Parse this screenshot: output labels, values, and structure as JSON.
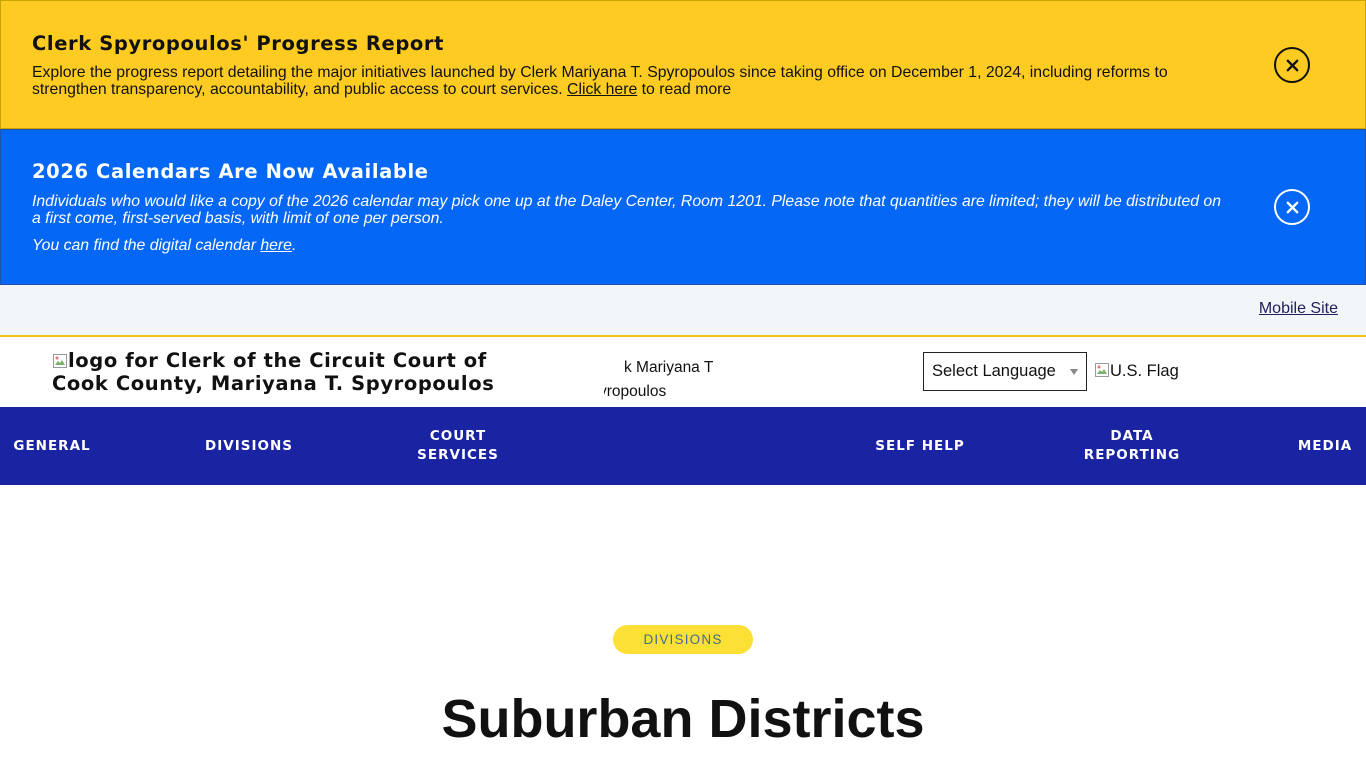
{
  "alerts": [
    {
      "title": "Clerk Spyropoulos' Progress Report",
      "body": "Explore the progress report detailing the major initiatives launched by Clerk Mariyana T. Spyropoulos since taking office on December 1, 2024, including reforms to strengthen transparency, accountability, and public access to court services.",
      "link_text": "Click here",
      "after_link": "to read more",
      "color": "#fdcb22"
    },
    {
      "title": "2026 Calendars Are Now Available",
      "body": "Individuals who would like a copy of the 2026 calendar may pick one up at the Daley Center, Room 1201. Please note that quantities are limited; they will be distributed on a first come, first-served basis, with limit of one per person.",
      "body2_prefix": "You can find the digital calendar",
      "link_text": "here",
      "body2_suffix": ".",
      "color": "#0467f6"
    }
  ],
  "utility": {
    "mobile_site": "Mobile Site"
  },
  "header": {
    "logo_alt": "logo for Clerk of the Circuit Court of Cook County, Mariyana T. Spyropoulos",
    "clipped_line1": "k Mariyana T",
    "clipped_line2": "yropoulos",
    "language_select": "Select Language",
    "flag_alt": "U.S. Flag"
  },
  "nav": {
    "items": [
      {
        "label": "GENERAL"
      },
      {
        "label": "DIVISIONS"
      },
      {
        "label": "COURT SERVICES"
      },
      {
        "label": "SELF HELP"
      },
      {
        "label": "DATA REPORTING"
      },
      {
        "label": "MEDIA"
      }
    ],
    "color": "#1a24a3"
  },
  "main": {
    "badge": "DIVISIONS",
    "title": "Suburban Districts"
  },
  "icons": {
    "close": "close-icon",
    "broken_image": "broken-image-icon"
  }
}
